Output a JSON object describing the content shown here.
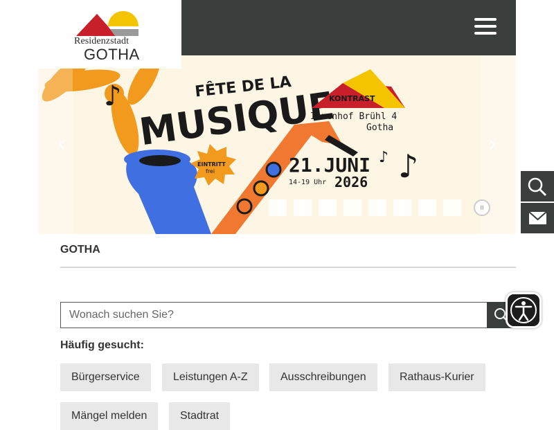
{
  "header": {
    "logo_line1": "Residenzstadt",
    "logo_line2": "GOTHA",
    "menu_icon": "hamburger-icon"
  },
  "slider": {
    "poster": {
      "title_top": "FÊTE DE LA",
      "title_main": "MUSIQUE",
      "brand": "KONTRAST",
      "venue_line1": "Innenhof Brühl 4",
      "venue_line2": "Gotha",
      "badge_line1": "EINTRITT",
      "badge_line2": "frei",
      "date": "21.JUNI",
      "time": "14-19 Uhr",
      "year": "2026"
    },
    "prev_icon": "chevron-left-icon",
    "next_icon": "chevron-right-icon",
    "pause_label": "II",
    "slide_count": 8,
    "active_slide": 1
  },
  "floating": {
    "search_icon": "search-icon",
    "mail_icon": "mail-icon"
  },
  "breadcrumb": {
    "current": "GOTHA"
  },
  "search": {
    "placeholder": "Wonach suchen Sie?",
    "value": ""
  },
  "frequent": {
    "label": "Häufig gesucht:",
    "items": [
      "Bürgerservice",
      "Leistungen A-Z",
      "Ausschreibungen",
      "Rathaus-Kurier",
      "Mängel melden",
      "Stadtrat"
    ]
  },
  "accessibility": {
    "icon": "accessibility-icon"
  },
  "colors": {
    "dark_bar": "#3a3e3c",
    "logo_red": "#c8202b",
    "logo_yellow": "#f5c400",
    "logo_grey": "#9a9a9a",
    "poster_orange": "#f29a1e",
    "poster_blue": "#3f6fe0",
    "chip_bg": "#e8e8e8"
  }
}
